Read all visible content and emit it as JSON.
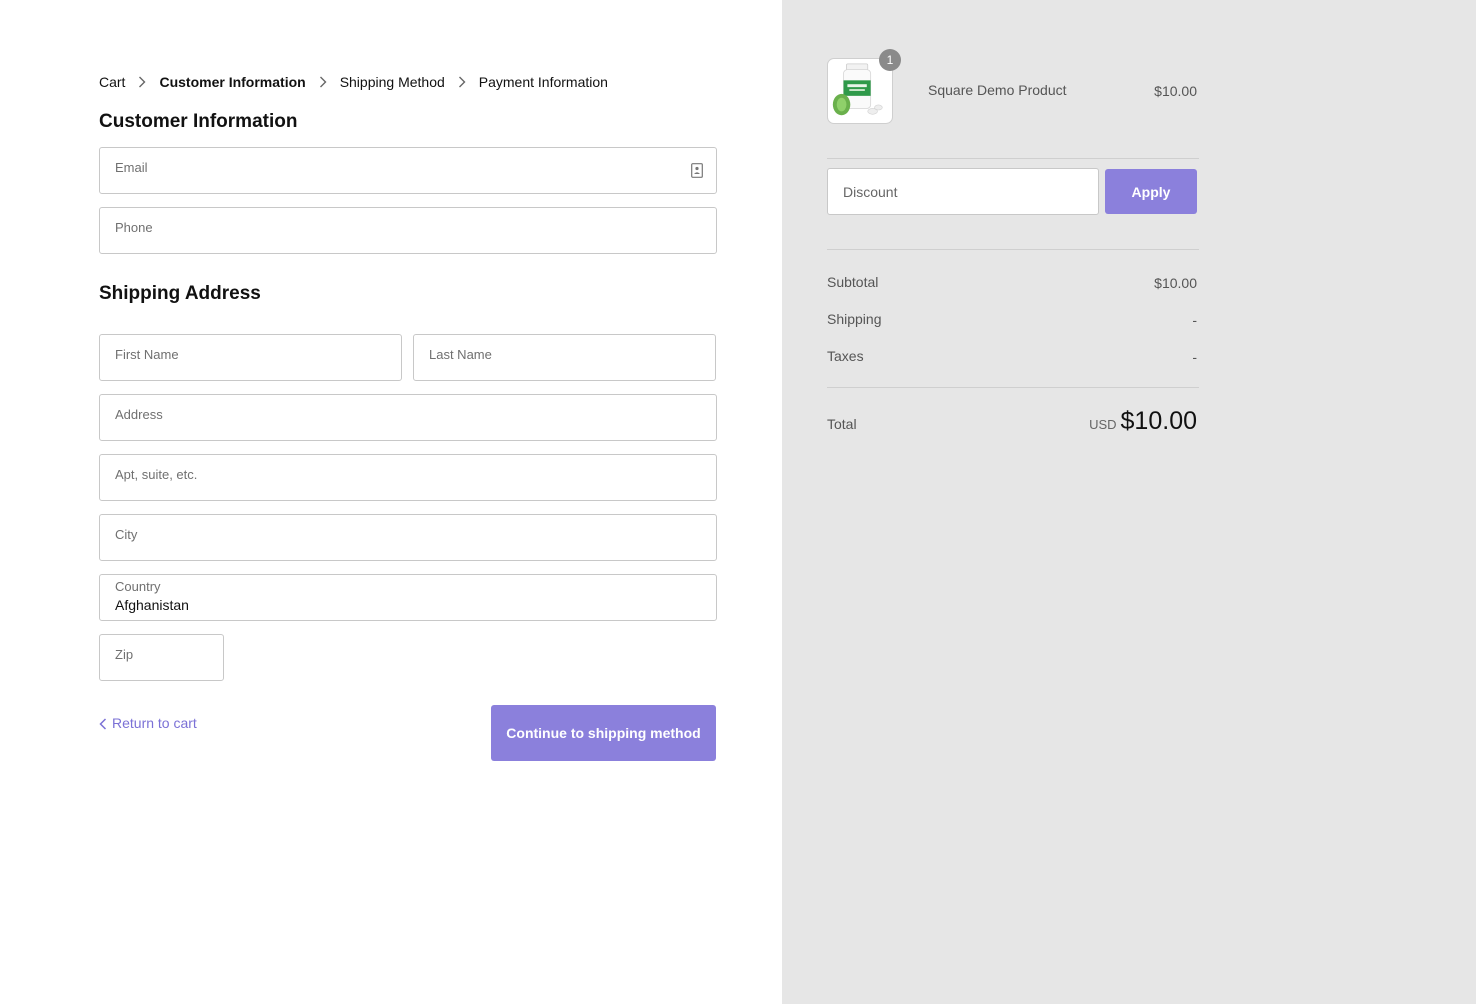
{
  "breadcrumb": {
    "items": [
      {
        "label": "Cart"
      },
      {
        "label": "Customer Information"
      },
      {
        "label": "Shipping Method"
      },
      {
        "label": "Payment Information"
      }
    ],
    "active": "Customer Information"
  },
  "customer": {
    "title": "Customer Information",
    "email_placeholder": "Email",
    "phone_placeholder": "Phone"
  },
  "shipping": {
    "title": "Shipping Address",
    "first_name_placeholder": "First Name",
    "last_name_placeholder": "Last Name",
    "address_placeholder": "Address",
    "apt_placeholder": "Apt, suite, etc.",
    "city_placeholder": "City",
    "country_label": "Country",
    "country_value": "Afghanistan",
    "zip_placeholder": "Zip"
  },
  "actions": {
    "return_label": "Return to cart",
    "continue_label": "Continue to shipping method"
  },
  "order": {
    "product": {
      "name": "Square Demo Product",
      "price": "$10.00",
      "quantity": "1"
    },
    "discount_placeholder": "Discount",
    "apply_label": "Apply",
    "subtotal_label": "Subtotal",
    "subtotal_value": "$10.00",
    "shipping_label": "Shipping",
    "shipping_value": "-",
    "taxes_label": "Taxes",
    "taxes_value": "-",
    "total_label": "Total",
    "currency": "USD",
    "total_value": "$10.00"
  },
  "colors": {
    "accent": "#8b80dc",
    "link": "#7b71d6",
    "sidebar_bg": "#e6e6e6"
  },
  "icons": {
    "breadcrumb_separator": "chevron-right-icon",
    "address_book": "address-book-icon",
    "back": "chevron-left-icon"
  }
}
